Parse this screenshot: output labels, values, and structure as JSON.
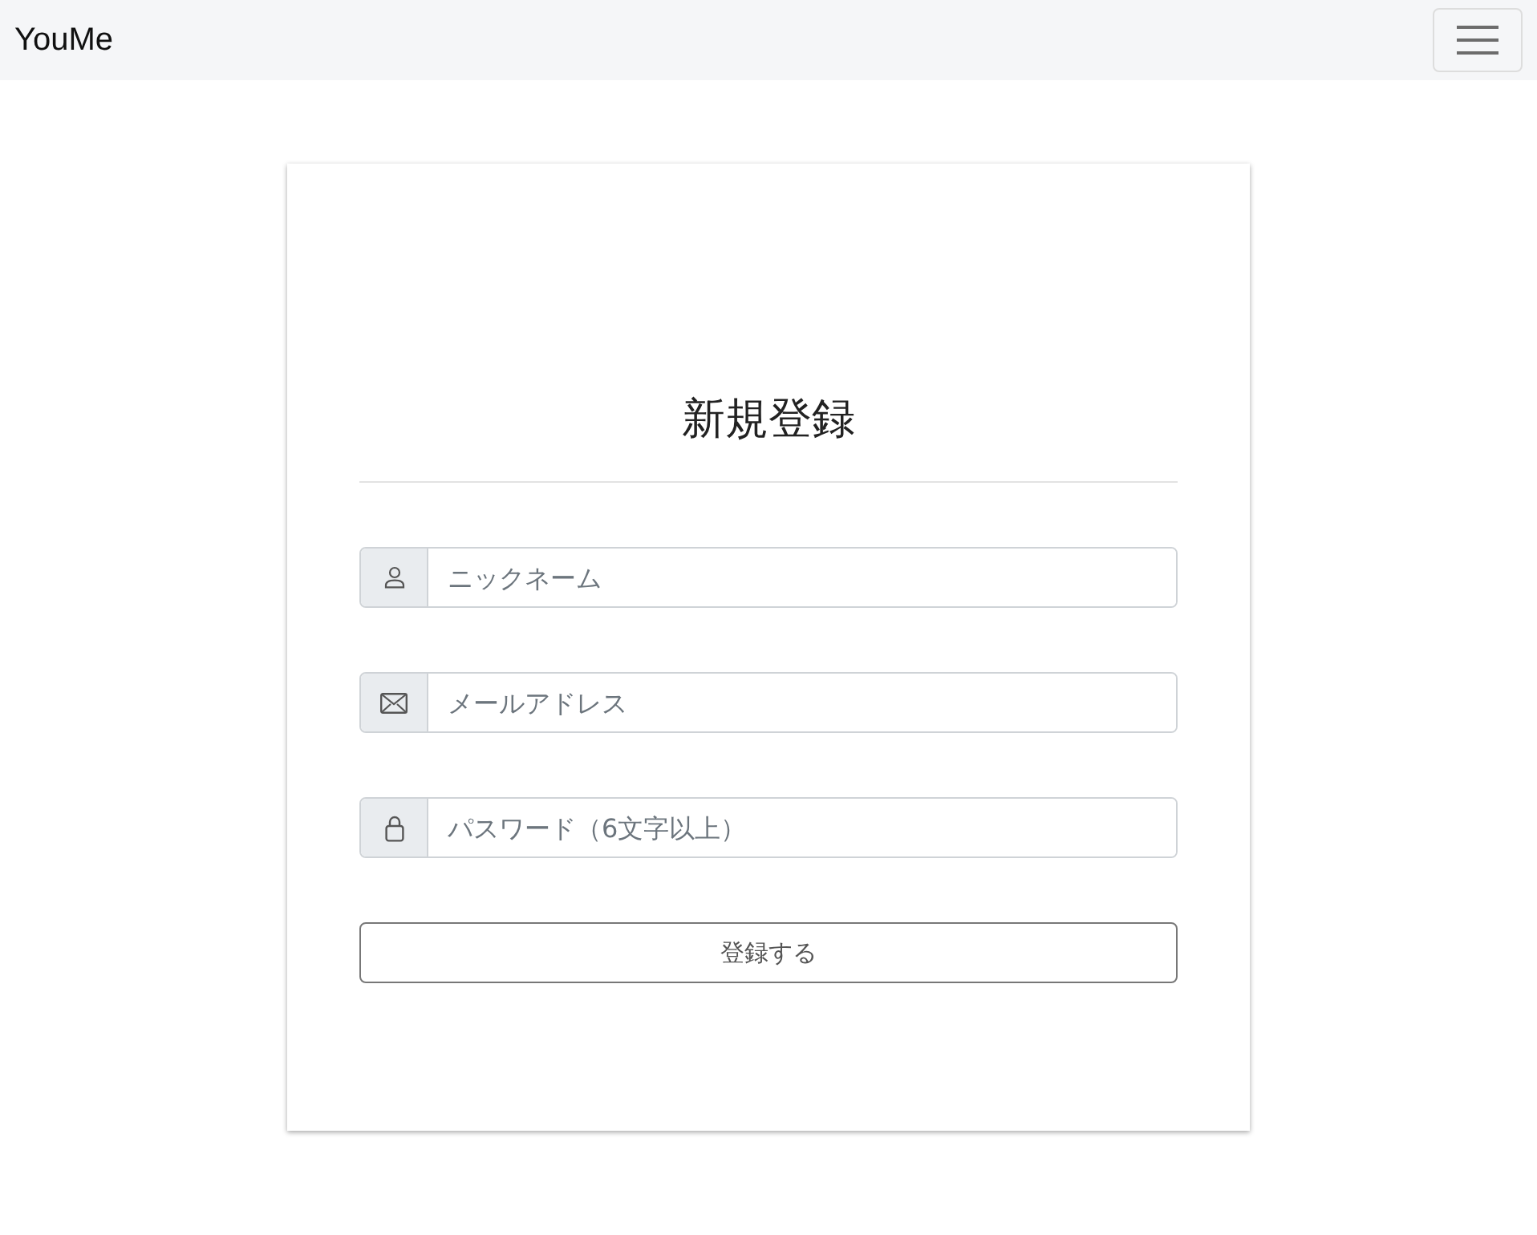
{
  "navbar": {
    "brand": "YouMe"
  },
  "form": {
    "title": "新規登録",
    "fields": [
      {
        "kind": "user",
        "placeholder": "ニックネーム"
      },
      {
        "kind": "mail",
        "placeholder": "メールアドレス"
      },
      {
        "kind": "lock",
        "placeholder": "パスワード（6文字以上）"
      }
    ],
    "submit": "登録する"
  }
}
